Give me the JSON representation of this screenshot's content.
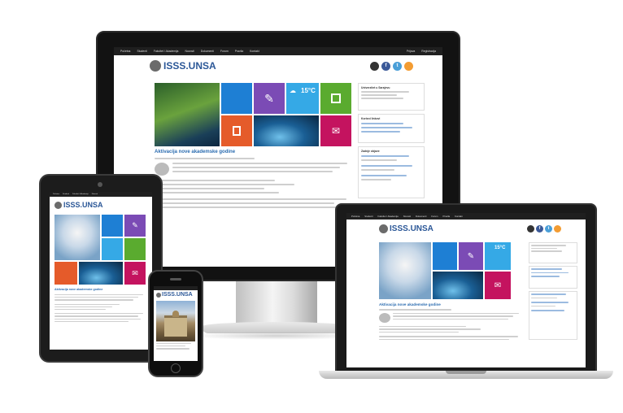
{
  "site": {
    "logo_text": "ISSS.UNSA",
    "nav_items": [
      "Početna",
      "Studenti",
      "Fakultet / Akademija",
      "Novosti",
      "Dokumenti",
      "Forum",
      "Pravila",
      "Kontakt"
    ],
    "nav_right": [
      "Prijava",
      "Registracija"
    ],
    "socials": [
      {
        "name": "github",
        "letter": "",
        "color": "#333333"
      },
      {
        "name": "facebook",
        "letter": "f",
        "color": "#3b5998"
      },
      {
        "name": "twitter",
        "letter": "t",
        "color": "#4a9fd8"
      },
      {
        "name": "rss",
        "letter": "",
        "color": "#f39c32"
      }
    ],
    "headline": "Aktivacija nove akademske godine",
    "weather_temp": "15°C",
    "sidebar": {
      "contact_title": "Univerzitet u Sarajevu",
      "links_title": "Korisni linkovi",
      "latest_title": "Zadnje objave"
    }
  },
  "colors": {
    "tile_blue": "#1e7fd4",
    "tile_purple": "#7b4bb5",
    "tile_sky": "#35a9e6",
    "tile_green": "#5aab2f",
    "tile_orange": "#e55b2a",
    "tile_magenta": "#c4135f",
    "link": "#2b6cb0"
  }
}
